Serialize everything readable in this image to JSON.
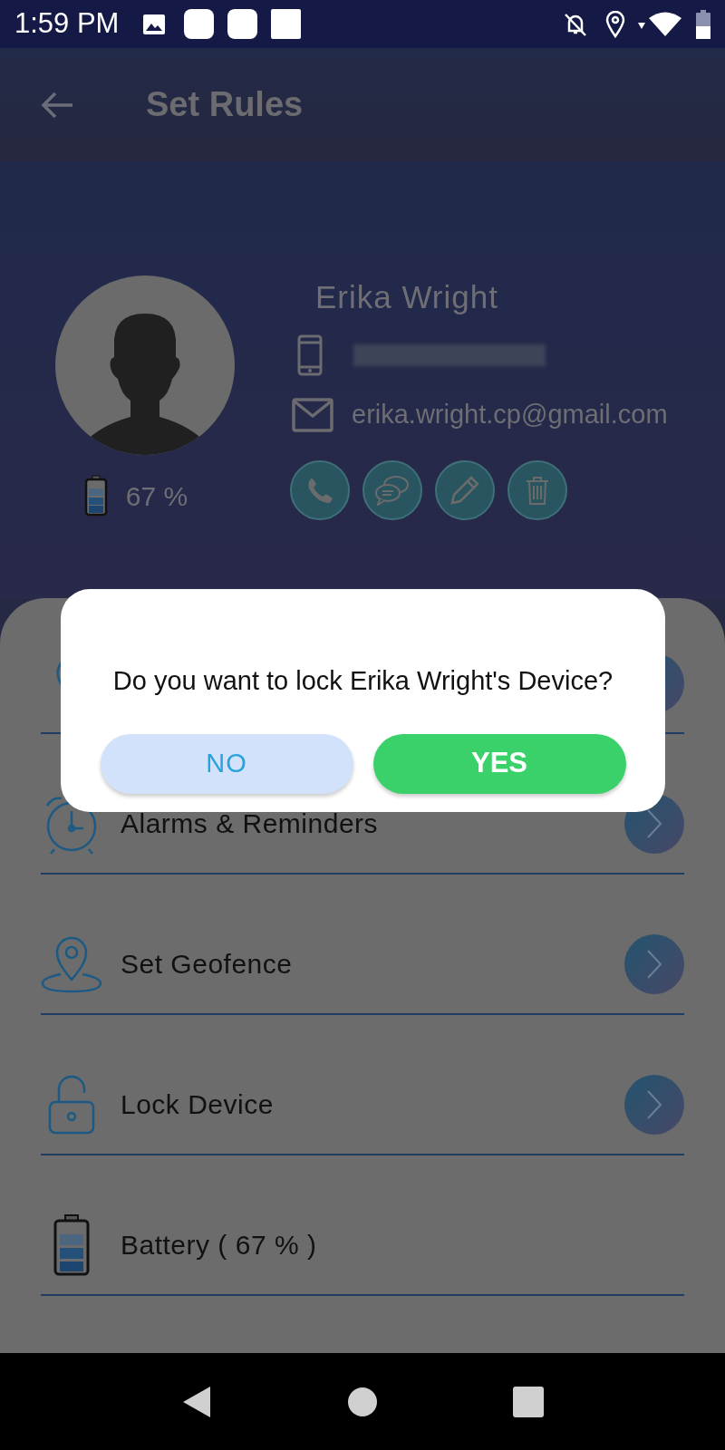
{
  "status_bar": {
    "time": "1:59 PM"
  },
  "app_bar": {
    "title": "Set Rules"
  },
  "profile": {
    "name": "Erika Wright",
    "email": "erika.wright.cp@gmail.com",
    "battery": "67 %"
  },
  "rules": [
    {
      "kind": "calls"
    },
    {
      "kind": "alarms",
      "label": "Alarms & Reminders"
    },
    {
      "kind": "geofence",
      "label": "Set Geofence"
    },
    {
      "kind": "lock",
      "label": "Lock Device"
    },
    {
      "kind": "battery",
      "label": "Battery ( 67 % )"
    }
  ],
  "dialog": {
    "message": "Do you want to lock Erika Wright's Device?",
    "buttons": [
      {
        "kind": "negative",
        "label": "NO"
      },
      {
        "kind": "positive",
        "label": "YES"
      }
    ]
  }
}
